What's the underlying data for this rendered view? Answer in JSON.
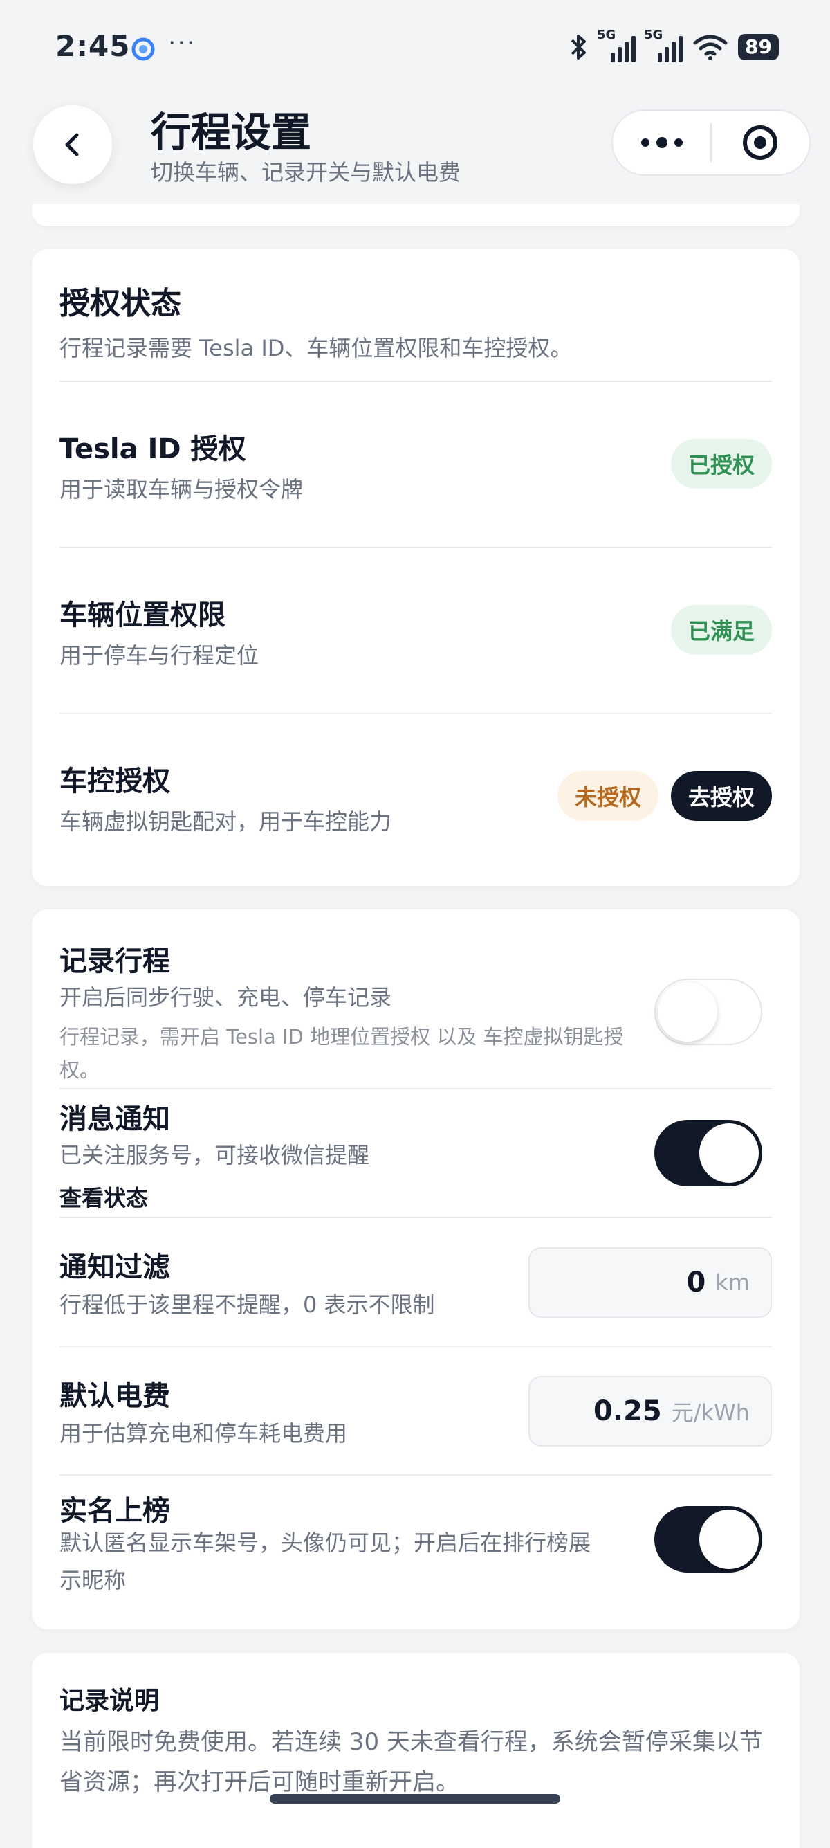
{
  "status_bar": {
    "time": "2:45",
    "more": "···",
    "network_1": "5G",
    "network_2": "5G",
    "battery": "89"
  },
  "header": {
    "title": "行程设置",
    "subtitle": "切换车辆、记录开关与默认电费"
  },
  "auth_card": {
    "title": "授权状态",
    "desc": "行程记录需要 Tesla ID、车辆位置权限和车控授权。",
    "items": [
      {
        "title": "Tesla ID 授权",
        "desc": "用于读取车辆与授权令牌",
        "status": "已授权"
      },
      {
        "title": "车辆位置权限",
        "desc": "用于停车与行程定位",
        "status": "已满足"
      },
      {
        "title": "车控授权",
        "desc": "车辆虚拟钥匙配对，用于车控能力",
        "status": "未授权",
        "action": "去授权"
      }
    ]
  },
  "settings_card": {
    "record_trip": {
      "title": "记录行程",
      "desc": "开启后同步行驶、充电、停车记录",
      "note": "行程记录，需开启 Tesla ID 地理位置授权 以及 车控虚拟钥匙授权。",
      "enabled": false
    },
    "notifications": {
      "title": "消息通知",
      "desc": "已关注服务号，可接收微信提醒",
      "link": "查看状态",
      "enabled": true
    },
    "notify_filter": {
      "title": "通知过滤",
      "desc": "行程低于该里程不提醒，0 表示不限制",
      "value": "0",
      "unit": "km"
    },
    "default_price": {
      "title": "默认电费",
      "desc": "用于估算充电和停车耗电费用",
      "value": "0.25",
      "unit": "元/kWh"
    },
    "leaderboard": {
      "title": "实名上榜",
      "desc": "默认匿名显示车架号，头像仍可见；开启后在排行榜展示昵称",
      "enabled": true
    }
  },
  "notes_card": {
    "title": "记录说明",
    "body": "当前限时免费使用。若连续 30 天未查看行程，系统会暂停采集以节省资源；再次打开后可随时重新开启。"
  },
  "colors": {
    "accent_dark": "#111827",
    "success": "#2f9254",
    "warning": "#b56a1f"
  }
}
